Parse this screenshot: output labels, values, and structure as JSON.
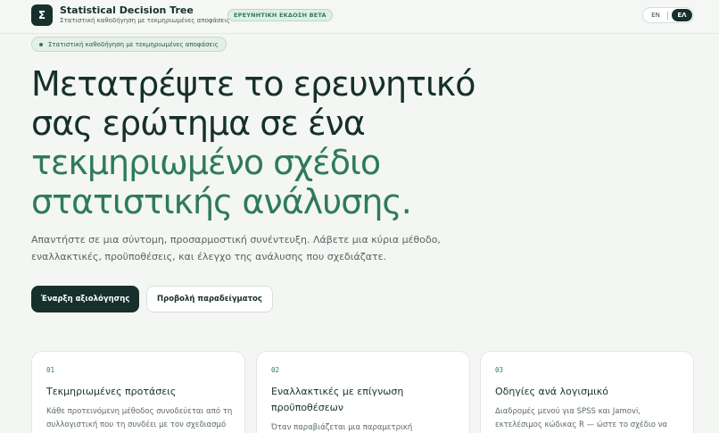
{
  "header": {
    "logo_glyph": "Σ",
    "title": "Statistical Decision Tree",
    "subtitle": "Στατιστική καθοδήγηση με τεκμηριωμένες αποφάσεις",
    "beta_badge": "ΕΡΕΥΝΗΤΙΚΗ ΕΚΔΟΣΗ BETA",
    "lang_en": "EN",
    "lang_el": "ΕΛ",
    "active_language": "ΕΛ"
  },
  "hero": {
    "eyebrow": "Στατιστική καθοδήγηση με τεκμηριωμένες αποφάσεις",
    "headline_lines": [
      "Μετατρέψτε το ερευνητικό",
      "σας ερώτημα σε ένα",
      "τεκμηριωμένο σχέδιο",
      "στατιστικής ανάλυσης."
    ],
    "lead": "Απαντήστε σε μια σύντομη, προσαρμοστική συνέντευξη. Λάβετε μια κύρια μέθοδο, εναλλακτικές, προϋποθέσεις, και έλεγχο της ανάλυσης που σχεδιάζατε.",
    "primary_button": "Έναρξη αξιολόγησης",
    "secondary_button": "Προβολή παραδείγματος"
  },
  "cards": [
    {
      "number": "01",
      "title": "Τεκμηριωμένες προτάσεις",
      "body": "Κάθε προτεινόμενη μέθοδος συνοδεύεται από τη συλλογιστική που τη συνδέει με τον σχεδιασμό"
    },
    {
      "number": "02",
      "title": "Εναλλακτικές με επίγνωση προϋποθέσεων",
      "body": "Όταν παραβιάζεται μια παραμετρική"
    },
    {
      "number": "03",
      "title": "Οδηγίες ανά λογισμικό",
      "body": "Διαδρομές μενού για SPSS και Jamovi, εκτελέσιμος κώδικας R — ώστε το σχέδιο να"
    }
  ],
  "colors": {
    "brand_dark": "#16302b",
    "accent_green": "#2e7a5e",
    "background": "#f4f6f3"
  }
}
